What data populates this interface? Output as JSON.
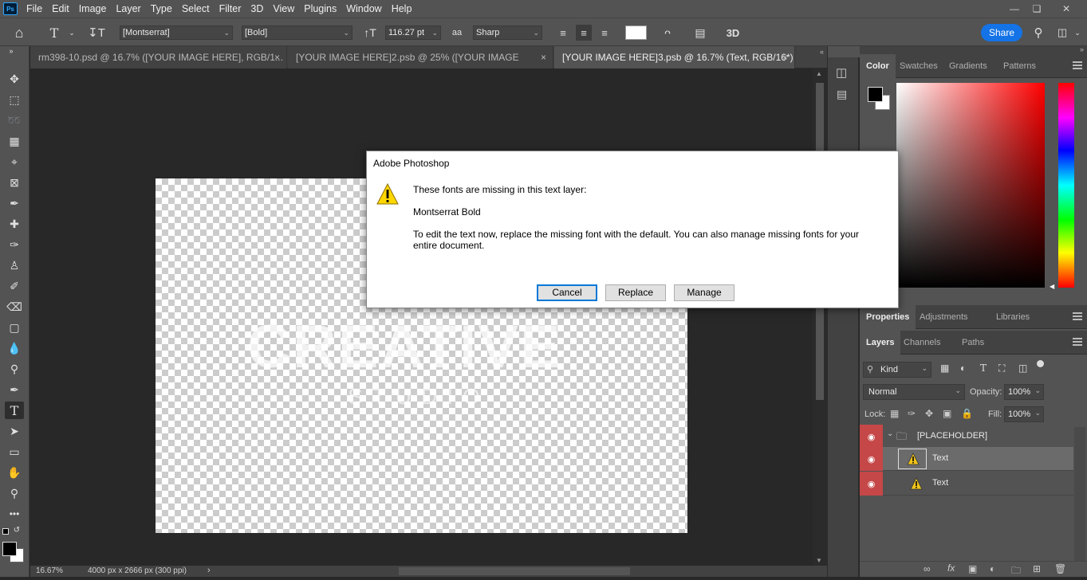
{
  "menubar": {
    "app_icon": "Ps",
    "items": [
      "File",
      "Edit",
      "Image",
      "Layer",
      "Type",
      "Select",
      "Filter",
      "3D",
      "View",
      "Plugins",
      "Window",
      "Help"
    ],
    "controls": [
      "minimize-icon",
      "restore-icon",
      "close-icon"
    ]
  },
  "options": {
    "font_family": "[Montserrat]",
    "font_style": "[Bold]",
    "font_size": "116.27 pt",
    "antialias": "Sharp",
    "three_d": "3D",
    "share": "Share",
    "text_color": "#ffffff"
  },
  "tabs": [
    {
      "label": "rm398-10.psd @ 16.7% ([YOUR IMAGE HERE], RGB/1...",
      "close": "×"
    },
    {
      "label": "[YOUR IMAGE HERE]2.psb @ 25% ([YOUR IMAGE HERE...",
      "close": "×"
    },
    {
      "label": "[YOUR IMAGE HERE]3.psb @ 16.7% (Text, RGB/16*)",
      "close": "×"
    }
  ],
  "canvas": {
    "title_text": "CREATIVE",
    "subtitle_text": "STUDIO"
  },
  "status": {
    "zoom": "16.67%",
    "doc_size": "4000 px x 2666 px (300 ppi)",
    "arrow": "›"
  },
  "dialog": {
    "title": "Adobe Photoshop",
    "line1": "These fonts are missing in this text layer:",
    "font_name": "Montserrat Bold",
    "line3a": "To edit the text now, replace the missing font with the default. You can also manage missing fonts for your",
    "line3b": "entire document.",
    "cancel": "Cancel",
    "replace": "Replace",
    "manage": "Manage"
  },
  "color_panel": {
    "tabs": [
      "Color",
      "Swatches",
      "Gradients",
      "Patterns"
    ],
    "foreground": "#000000",
    "background": "#ffffff"
  },
  "props_panel": {
    "tabs": [
      "Properties",
      "Adjustments",
      "Libraries"
    ]
  },
  "layers_panel": {
    "tabs": [
      "Layers",
      "Channels",
      "Paths"
    ],
    "filter_kind": "Kind",
    "blend_mode": "Normal",
    "opacity_label": "Opacity:",
    "opacity_value": "100%",
    "lock_label": "Lock:",
    "fill_label": "Fill:",
    "fill_value": "100%",
    "layers": [
      {
        "name": "[PLACEHOLDER]",
        "type": "group"
      },
      {
        "name": "Text",
        "type": "text-missing-font",
        "selected": true
      },
      {
        "name": "Text",
        "type": "text-missing-font",
        "selected": false
      }
    ]
  }
}
